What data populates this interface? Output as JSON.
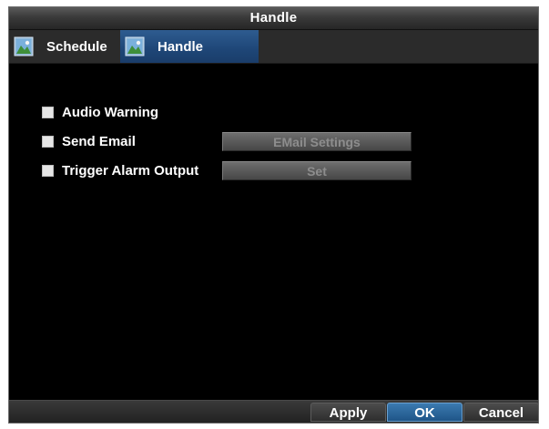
{
  "window": {
    "title": "Handle"
  },
  "tabs": [
    {
      "label": "Schedule",
      "icon": "image-icon",
      "active": false
    },
    {
      "label": "Handle",
      "icon": "image-icon",
      "active": true
    }
  ],
  "options": [
    {
      "label": "Audio Warning",
      "checked": false
    },
    {
      "label": "Send Email",
      "checked": false,
      "button_label": "EMail Settings"
    },
    {
      "label": "Trigger Alarm Output",
      "checked": false,
      "button_label": "Set"
    }
  ],
  "footer": {
    "apply_label": "Apply",
    "ok_label": "OK",
    "cancel_label": "Cancel"
  },
  "colors": {
    "active_tab": "#1e4677",
    "focused_button": "#2f6aa0"
  }
}
